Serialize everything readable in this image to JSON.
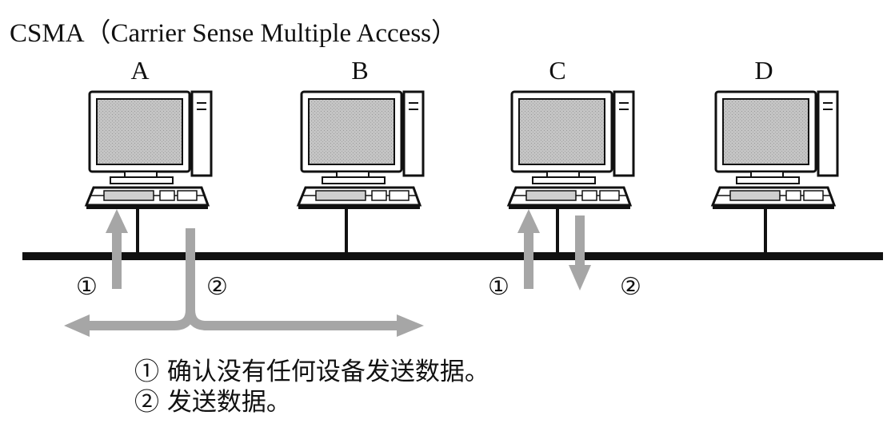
{
  "title": "CSMA（Carrier Sense Multiple Access）",
  "nodes": [
    {
      "label": "A"
    },
    {
      "label": "B"
    },
    {
      "label": "C"
    },
    {
      "label": "D"
    }
  ],
  "steps": {
    "one": "①",
    "two": "②"
  },
  "legend": {
    "line1": "① 确认没有任何设备发送数据。",
    "line2": "② 发送数据。"
  },
  "colors": {
    "line": "#111111",
    "arrow": "#a6a6a6",
    "screen": "#bdbdbd"
  },
  "icons": [
    "desktop-computer-icon"
  ]
}
